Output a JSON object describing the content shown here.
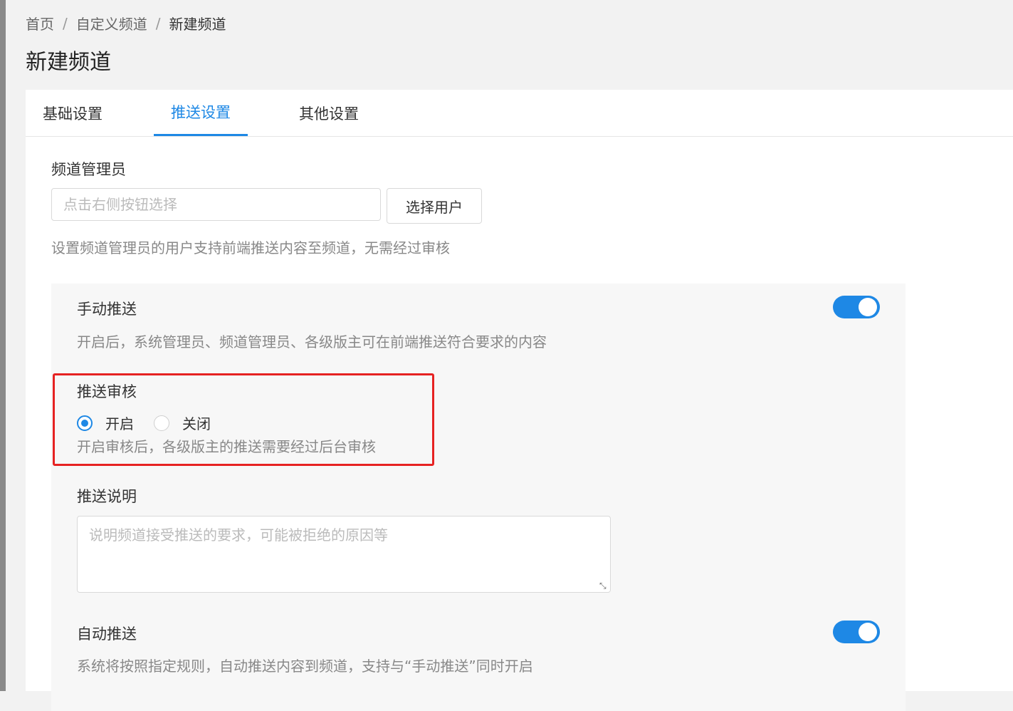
{
  "breadcrumb": {
    "items": [
      "首页",
      "自定义频道",
      "新建频道"
    ],
    "separator": "/"
  },
  "page_title": "新建频道",
  "tabs": [
    {
      "label": "基础设置",
      "active": false
    },
    {
      "label": "推送设置",
      "active": true
    },
    {
      "label": "其他设置",
      "active": false
    }
  ],
  "admin": {
    "label": "频道管理员",
    "placeholder": "点击右侧按钮选择",
    "button_label": "选择用户",
    "help": "设置频道管理员的用户支持前端推送内容至频道，无需经过审核"
  },
  "manual_push": {
    "label": "手动推送",
    "enabled": true,
    "help": "开启后，系统管理员、频道管理员、各级版主可在前端推送符合要求的内容"
  },
  "push_review": {
    "label": "推送审核",
    "options": [
      {
        "label": "开启",
        "checked": true
      },
      {
        "label": "关闭",
        "checked": false
      }
    ],
    "help": "开启审核后，各级版主的推送需要经过后台审核"
  },
  "push_description": {
    "label": "推送说明",
    "placeholder": "说明频道接受推送的要求，可能被拒绝的原因等"
  },
  "auto_push": {
    "label": "自动推送",
    "enabled": true,
    "help": "系统将按照指定规则，自动推送内容到频道，支持与“手动推送”同时开启"
  },
  "colors": {
    "accent": "#1e88e5",
    "highlight": "#e62222"
  }
}
